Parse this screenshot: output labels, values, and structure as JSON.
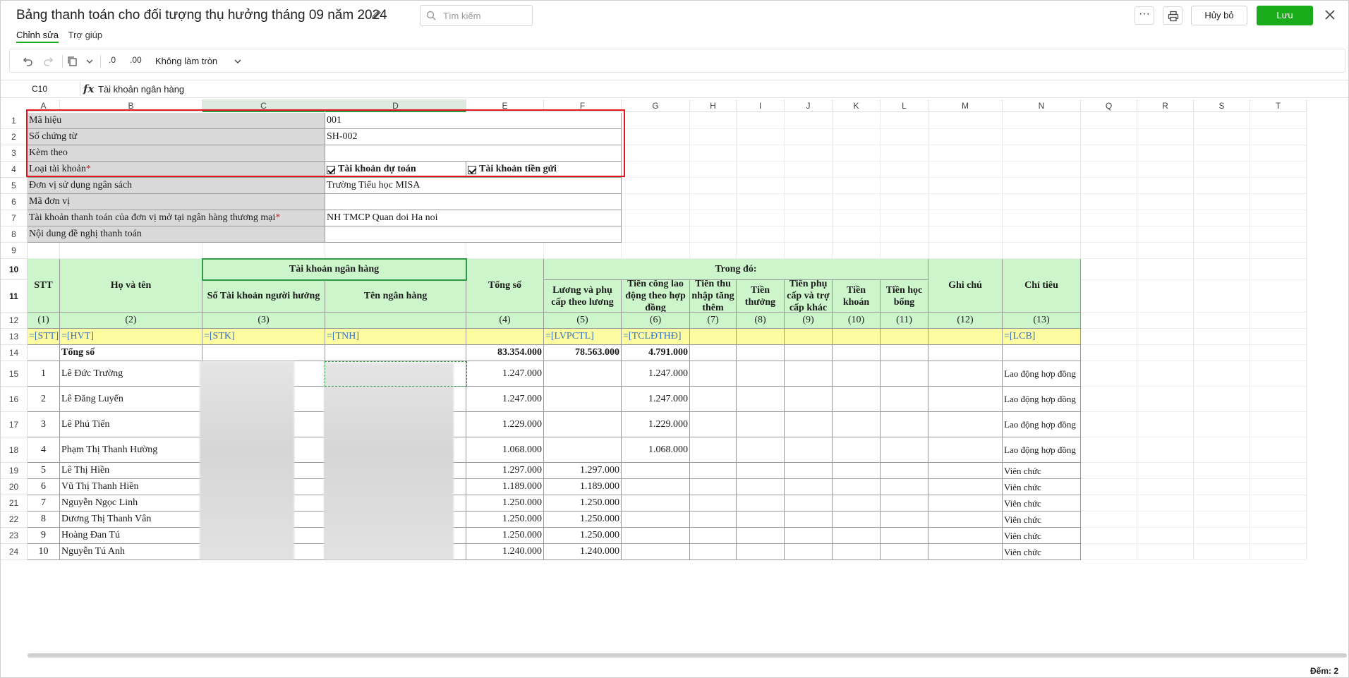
{
  "header": {
    "title": "Bảng thanh toán cho đối tượng thụ hưởng tháng 09 năm 2024",
    "search_placeholder": "Tìm kiếm",
    "more_label": "···",
    "cancel_label": "Hủy bỏ",
    "save_label": "Lưu"
  },
  "tabs": [
    "Chỉnh sửa",
    "Trợ giúp"
  ],
  "toolbar": {
    "dec_decrease": ".0",
    "dec_increase": ".00",
    "rounding_label": "Không làm tròn"
  },
  "formula_bar": {
    "cell_ref": "C10",
    "fx": "fx",
    "value": "Tài khoản ngân hàng"
  },
  "columns": [
    "A",
    "B",
    "C",
    "D",
    "E",
    "F",
    "G",
    "H",
    "I",
    "J",
    "K",
    "L",
    "M",
    "N",
    "Q",
    "R",
    "S",
    "T"
  ],
  "rows": [
    "1",
    "2",
    "3",
    "4",
    "5",
    "6",
    "7",
    "8",
    "9",
    "10",
    "11",
    "12",
    "13",
    "14",
    "15",
    "16",
    "17",
    "18",
    "19",
    "20",
    "21",
    "22",
    "23",
    "24"
  ],
  "info_rows": [
    {
      "label": "Mã hiệu",
      "value": "001",
      "required": ""
    },
    {
      "label": "Số chứng từ",
      "value": "SH-002",
      "required": ""
    },
    {
      "label": "Kèm theo",
      "value": "",
      "required": ""
    },
    {
      "label": "Loại tài khoản",
      "value": "",
      "required": "*"
    },
    {
      "label": "Đơn vị sử dụng ngân sách",
      "value": "Trường Tiểu học MISA",
      "required": ""
    },
    {
      "label": "Mã đơn vị",
      "value": "",
      "required": ""
    },
    {
      "label": "Tài khoản thanh toán của đơn vị mở tại ngân hàng thương mại",
      "value": "NH TMCP Quan doi Ha noi",
      "required": "*"
    },
    {
      "label": "Nội dung đề nghị thanh toán",
      "value": "",
      "required": ""
    }
  ],
  "account_types": [
    "Tài khoản dự toán",
    "Tài khoản tiền gửi"
  ],
  "table_header": {
    "stt": "STT",
    "name": "Họ và tên",
    "bank_group": "Tài khoản ngân hàng",
    "account_no": "Số Tài khoản người hưởng",
    "bank_name": "Tên ngân hàng",
    "total": "Tổng số",
    "of_which": "Trong đó:",
    "salary": "Lương và phụ cấp theo lương",
    "contract": "Tiền công lao động theo hợp đồng",
    "extra_income": "Tiền thu nhập tăng thêm",
    "bonus": "Tiền thưởng",
    "allowance": "Tiền phụ cấp và trợ cấp khác",
    "lump_sum": "Tiền khoán",
    "scholarship": "Tiền học bổng",
    "note": "Ghi chú",
    "budget_item": "Chỉ tiêu"
  },
  "col_numbers": [
    "(1)",
    "(2)",
    "(3)",
    "",
    "(4)",
    "(5)",
    "(6)",
    "(7)",
    "(8)",
    "(9)",
    "(10)",
    "(11)",
    "(12)",
    "(13)"
  ],
  "formula_row": [
    "=[STT]",
    "=[HVT]",
    "=[STK]",
    "=[TNH]",
    "",
    "=[LVPCTL]",
    "=[TCLĐTHĐ]",
    "",
    "",
    "",
    "",
    "",
    "",
    "=[LCB]"
  ],
  "total_row": {
    "label": "Tổng số",
    "total": "83.354.000",
    "salary": "78.563.000",
    "contract": "4.791.000"
  },
  "people": [
    {
      "stt": "1",
      "name": "Lê Đức Trường",
      "total": "1.247.000",
      "salary": "",
      "contract": "1.247.000",
      "budget": "Lao động hợp đồng"
    },
    {
      "stt": "2",
      "name": "Lê Đăng Luyến",
      "total": "1.247.000",
      "salary": "",
      "contract": "1.247.000",
      "budget": "Lao động hợp đồng"
    },
    {
      "stt": "3",
      "name": "Lê Phú Tiến",
      "total": "1.229.000",
      "salary": "",
      "contract": "1.229.000",
      "budget": "Lao động hợp đồng"
    },
    {
      "stt": "4",
      "name": "Phạm Thị Thanh  Hường",
      "total": "1.068.000",
      "salary": "",
      "contract": "1.068.000",
      "budget": "Lao động hợp đồng"
    },
    {
      "stt": "5",
      "name": "Lê Thị Hiền",
      "total": "1.297.000",
      "salary": "1.297.000",
      "contract": "",
      "budget": "Viên chức"
    },
    {
      "stt": "6",
      "name": "Vũ Thị Thanh Hiền",
      "total": "1.189.000",
      "salary": "1.189.000",
      "contract": "",
      "budget": "Viên chức"
    },
    {
      "stt": "7",
      "name": "Nguyễn Ngọc Linh",
      "total": "1.250.000",
      "salary": "1.250.000",
      "contract": "",
      "budget": "Viên chức"
    },
    {
      "stt": "8",
      "name": "Dương Thị Thanh Vân",
      "total": "1.250.000",
      "salary": "1.250.000",
      "contract": "",
      "budget": "Viên chức"
    },
    {
      "stt": "9",
      "name": "Hoàng Đan Tú",
      "total": "1.250.000",
      "salary": "1.250.000",
      "contract": "",
      "budget": "Viên chức"
    },
    {
      "stt": "10",
      "name": "Nguyễn Tú Anh",
      "total": "1.240.000",
      "salary": "1.240.000",
      "contract": "",
      "budget": "Viên chức"
    }
  ],
  "status": {
    "count_label": "Đếm: 2"
  }
}
